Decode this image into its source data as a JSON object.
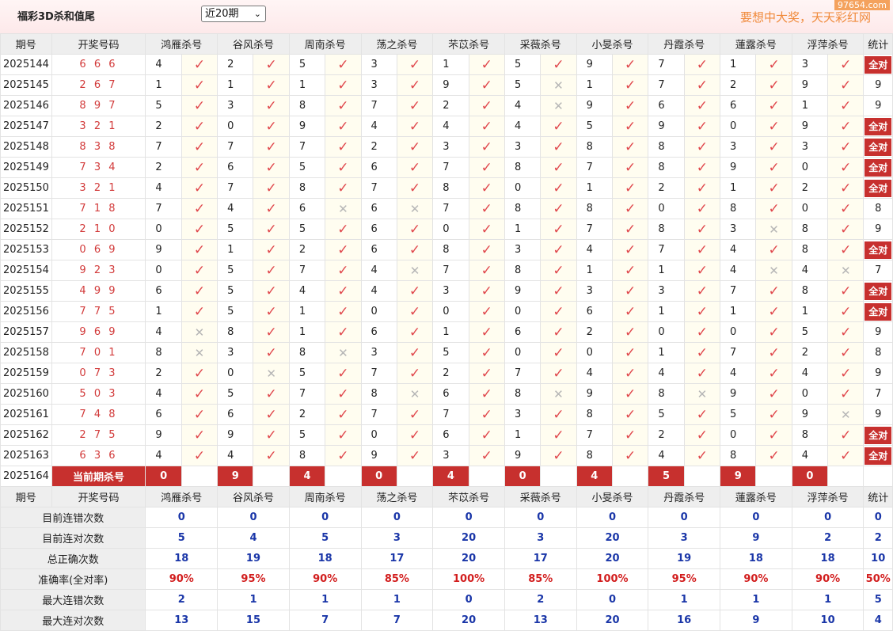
{
  "header": {
    "title": "福彩3D杀和值尾",
    "period_select": "近20期",
    "slogan": "要想中大奖，天天彩红网",
    "watermark": "97654.com"
  },
  "columns": {
    "issue": "期号",
    "number": "开奖号码",
    "experts": [
      "鸿雁杀号",
      "谷风杀号",
      "周南杀号",
      "荡之杀号",
      "芣苡杀号",
      "采薇杀号",
      "小旻杀号",
      "丹霞杀号",
      "蓮露杀号",
      "浮萍杀号"
    ],
    "stat": "统计"
  },
  "all_correct_label": "全对",
  "rows": [
    {
      "issue": "2025144",
      "num": "6 6 6",
      "kills": [
        4,
        2,
        5,
        3,
        1,
        5,
        9,
        7,
        1,
        3
      ],
      "hits": [
        1,
        1,
        1,
        1,
        1,
        1,
        1,
        1,
        1,
        1
      ],
      "stat": "全对"
    },
    {
      "issue": "2025145",
      "num": "2 6 7",
      "kills": [
        1,
        1,
        1,
        3,
        9,
        5,
        1,
        7,
        2,
        9
      ],
      "hits": [
        1,
        1,
        1,
        1,
        1,
        0,
        1,
        1,
        1,
        1
      ],
      "stat": "9"
    },
    {
      "issue": "2025146",
      "num": "8 9 7",
      "kills": [
        5,
        3,
        8,
        7,
        2,
        4,
        9,
        6,
        6,
        1
      ],
      "hits": [
        1,
        1,
        1,
        1,
        1,
        0,
        1,
        1,
        1,
        1
      ],
      "stat": "9"
    },
    {
      "issue": "2025147",
      "num": "3 2 1",
      "kills": [
        2,
        0,
        9,
        4,
        4,
        4,
        5,
        9,
        0,
        9
      ],
      "hits": [
        1,
        1,
        1,
        1,
        1,
        1,
        1,
        1,
        1,
        1
      ],
      "stat": "全对"
    },
    {
      "issue": "2025148",
      "num": "8 3 8",
      "kills": [
        7,
        7,
        7,
        2,
        3,
        3,
        8,
        8,
        3,
        3
      ],
      "hits": [
        1,
        1,
        1,
        1,
        1,
        1,
        1,
        1,
        1,
        1
      ],
      "stat": "全对"
    },
    {
      "issue": "2025149",
      "num": "7 3 4",
      "kills": [
        2,
        6,
        5,
        6,
        7,
        8,
        7,
        8,
        9,
        0
      ],
      "hits": [
        1,
        1,
        1,
        1,
        1,
        1,
        1,
        1,
        1,
        1
      ],
      "stat": "全对"
    },
    {
      "issue": "2025150",
      "num": "3 2 1",
      "kills": [
        4,
        7,
        8,
        7,
        8,
        0,
        1,
        2,
        1,
        2
      ],
      "hits": [
        1,
        1,
        1,
        1,
        1,
        1,
        1,
        1,
        1,
        1
      ],
      "stat": "全对"
    },
    {
      "issue": "2025151",
      "num": "7 1 8",
      "kills": [
        7,
        4,
        6,
        6,
        7,
        8,
        8,
        0,
        8,
        0
      ],
      "hits": [
        1,
        1,
        0,
        0,
        1,
        1,
        1,
        1,
        1,
        1
      ],
      "stat": "8"
    },
    {
      "issue": "2025152",
      "num": "2 1 0",
      "kills": [
        0,
        5,
        5,
        6,
        0,
        1,
        7,
        8,
        3,
        8
      ],
      "hits": [
        1,
        1,
        1,
        1,
        1,
        1,
        1,
        1,
        0,
        1
      ],
      "stat": "9"
    },
    {
      "issue": "2025153",
      "num": "0 6 9",
      "kills": [
        9,
        1,
        2,
        6,
        8,
        3,
        4,
        7,
        4,
        8
      ],
      "hits": [
        1,
        1,
        1,
        1,
        1,
        1,
        1,
        1,
        1,
        1
      ],
      "stat": "全对"
    },
    {
      "issue": "2025154",
      "num": "9 2 3",
      "kills": [
        0,
        5,
        7,
        4,
        7,
        8,
        1,
        1,
        4,
        4
      ],
      "hits": [
        1,
        1,
        1,
        0,
        1,
        1,
        1,
        1,
        0,
        0
      ],
      "stat": "7"
    },
    {
      "issue": "2025155",
      "num": "4 9 9",
      "kills": [
        6,
        5,
        4,
        4,
        3,
        9,
        3,
        3,
        7,
        8
      ],
      "hits": [
        1,
        1,
        1,
        1,
        1,
        1,
        1,
        1,
        1,
        1
      ],
      "stat": "全对"
    },
    {
      "issue": "2025156",
      "num": "7 7 5",
      "kills": [
        1,
        5,
        1,
        0,
        0,
        0,
        6,
        1,
        1,
        1
      ],
      "hits": [
        1,
        1,
        1,
        1,
        1,
        1,
        1,
        1,
        1,
        1
      ],
      "stat": "全对"
    },
    {
      "issue": "2025157",
      "num": "9 6 9",
      "kills": [
        4,
        8,
        1,
        6,
        1,
        6,
        2,
        0,
        0,
        5
      ],
      "hits": [
        0,
        1,
        1,
        1,
        1,
        1,
        1,
        1,
        1,
        1
      ],
      "stat": "9"
    },
    {
      "issue": "2025158",
      "num": "7 0 1",
      "kills": [
        8,
        3,
        8,
        3,
        5,
        0,
        0,
        1,
        7,
        2
      ],
      "hits": [
        0,
        1,
        0,
        1,
        1,
        1,
        1,
        1,
        1,
        1
      ],
      "stat": "8"
    },
    {
      "issue": "2025159",
      "num": "0 7 3",
      "kills": [
        2,
        0,
        5,
        7,
        2,
        7,
        4,
        4,
        4,
        4
      ],
      "hits": [
        1,
        0,
        1,
        1,
        1,
        1,
        1,
        1,
        1,
        1
      ],
      "stat": "9"
    },
    {
      "issue": "2025160",
      "num": "5 0 3",
      "kills": [
        4,
        5,
        7,
        8,
        6,
        8,
        9,
        8,
        9,
        0
      ],
      "hits": [
        1,
        1,
        1,
        0,
        1,
        0,
        1,
        0,
        1,
        1
      ],
      "stat": "7"
    },
    {
      "issue": "2025161",
      "num": "7 4 8",
      "kills": [
        6,
        6,
        2,
        7,
        7,
        3,
        8,
        5,
        5,
        9
      ],
      "hits": [
        1,
        1,
        1,
        1,
        1,
        1,
        1,
        1,
        1,
        0
      ],
      "stat": "9"
    },
    {
      "issue": "2025162",
      "num": "2 7 5",
      "kills": [
        9,
        9,
        5,
        0,
        6,
        1,
        7,
        2,
        0,
        8
      ],
      "hits": [
        1,
        1,
        1,
        1,
        1,
        1,
        1,
        1,
        1,
        1
      ],
      "stat": "全对"
    },
    {
      "issue": "2025163",
      "num": "6 3 6",
      "kills": [
        4,
        4,
        8,
        9,
        3,
        9,
        8,
        4,
        8,
        4
      ],
      "hits": [
        1,
        1,
        1,
        1,
        1,
        1,
        1,
        1,
        1,
        1
      ],
      "stat": "全对"
    }
  ],
  "current": {
    "issue": "2025164",
    "label": "当前期杀号",
    "kills": [
      "0",
      "9",
      "4",
      "0",
      "4",
      "0",
      "4",
      "5",
      "9",
      "0"
    ]
  },
  "stats": [
    {
      "label": "目前连错次数",
      "values": [
        "0",
        "0",
        "0",
        "0",
        "0",
        "0",
        "0",
        "0",
        "0",
        "0"
      ],
      "total": "0",
      "style": "sv"
    },
    {
      "label": "目前连对次数",
      "values": [
        "5",
        "4",
        "5",
        "3",
        "20",
        "3",
        "20",
        "3",
        "9",
        "2"
      ],
      "total": "2",
      "style": "sv"
    },
    {
      "label": "总正确次数",
      "values": [
        "18",
        "19",
        "18",
        "17",
        "20",
        "17",
        "20",
        "19",
        "18",
        "18"
      ],
      "total": "10",
      "style": "sv"
    },
    {
      "label": "准确率(全对率)",
      "values": [
        "90%",
        "95%",
        "90%",
        "85%",
        "100%",
        "85%",
        "100%",
        "95%",
        "90%",
        "90%"
      ],
      "total": "50%",
      "style": "sr"
    },
    {
      "label": "最大连错次数",
      "values": [
        "2",
        "1",
        "1",
        "1",
        "0",
        "2",
        "0",
        "1",
        "1",
        "1"
      ],
      "total": "5",
      "style": "sv"
    },
    {
      "label": "最大连对次数",
      "values": [
        "13",
        "15",
        "7",
        "7",
        "20",
        "13",
        "20",
        "16",
        "9",
        "10"
      ],
      "total": "4",
      "style": "sv"
    }
  ],
  "icons": {
    "correct": "check-icon",
    "wrong": "cross-icon"
  },
  "colors": {
    "accent_red": "#c7302e",
    "check_red": "#e0474c",
    "stat_blue": "#1a36a8",
    "slogan_orange": "#f08a3b"
  }
}
